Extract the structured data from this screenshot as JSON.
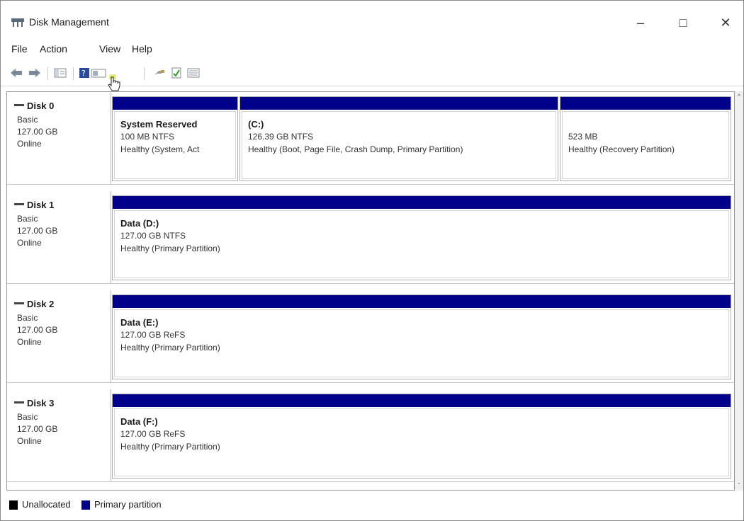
{
  "window": {
    "title": "Disk Management"
  },
  "menu": [
    "File",
    "Action",
    "View",
    "Help"
  ],
  "toolbar": {
    "icons": [
      "back-arrow-icon",
      "forward-arrow-icon",
      "console-tree-icon",
      "help-icon",
      "properties-icon",
      "connect-icon",
      "check-icon",
      "list-view-icon"
    ]
  },
  "disks": [
    {
      "name": "Disk 0",
      "type": "Basic",
      "size": "127.00 GB",
      "status": "Online",
      "partitions": [
        {
          "name": "System Reserved",
          "size": "100 MB NTFS",
          "health": "Healthy (System, Act"
        },
        {
          "name": "(C:)",
          "size": "126.39 GB NTFS",
          "health": "Healthy (Boot, Page File, Crash Dump, Primary Partition)"
        },
        {
          "name": "",
          "size": "523 MB",
          "health": "Healthy (Recovery Partition)"
        }
      ]
    },
    {
      "name": "Disk 1",
      "type": "Basic",
      "size": "127.00 GB",
      "status": "Online",
      "partitions": [
        {
          "name": "Data  (D:)",
          "size": "127.00 GB NTFS",
          "health": "Healthy (Primary Partition)"
        }
      ]
    },
    {
      "name": "Disk 2",
      "type": "Basic",
      "size": "127.00 GB",
      "status": "Online",
      "partitions": [
        {
          "name": "Data  (E:)",
          "size": "127.00 GB ReFS",
          "health": "Healthy (Primary Partition)"
        }
      ]
    },
    {
      "name": "Disk 3",
      "type": "Basic",
      "size": "127.00 GB",
      "status": "Online",
      "partitions": [
        {
          "name": "Data  (F:)",
          "size": "127.00 GB ReFS",
          "health": "Healthy (Primary Partition)"
        }
      ]
    }
  ],
  "legend": [
    {
      "label": "Unallocated",
      "color": "#000000"
    },
    {
      "label": "Primary partition",
      "color": "#00008b"
    }
  ],
  "colors": {
    "primary_partition": "#00008b",
    "unallocated": "#000000"
  }
}
